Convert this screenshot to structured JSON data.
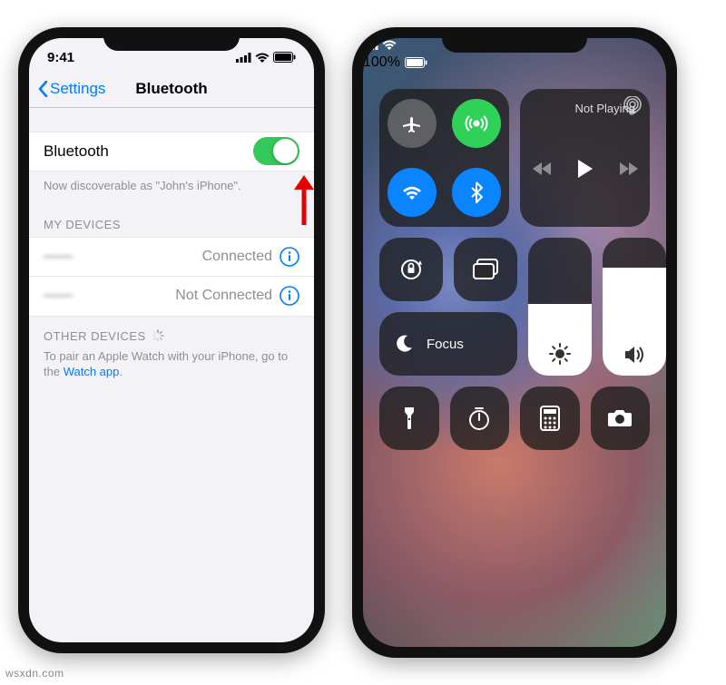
{
  "left": {
    "time": "9:41",
    "back_label": "Settings",
    "title": "Bluetooth",
    "bluetooth_label": "Bluetooth",
    "bluetooth_on": true,
    "discoverable": "Now discoverable as \"John's iPhone\".",
    "my_devices_header": "MY DEVICES",
    "devices": [
      {
        "name": "——",
        "status": "Connected"
      },
      {
        "name": "——",
        "status": "Not Connected"
      }
    ],
    "other_devices_header": "OTHER DEVICES",
    "pair_text_1": "To pair an Apple Watch with your iPhone, go to the ",
    "pair_text_link": "Watch app",
    "pair_text_2": "."
  },
  "right": {
    "battery_text": "100%",
    "now_playing": "Not Playing",
    "focus_label": "Focus"
  },
  "watermark": "wsxdn.com"
}
